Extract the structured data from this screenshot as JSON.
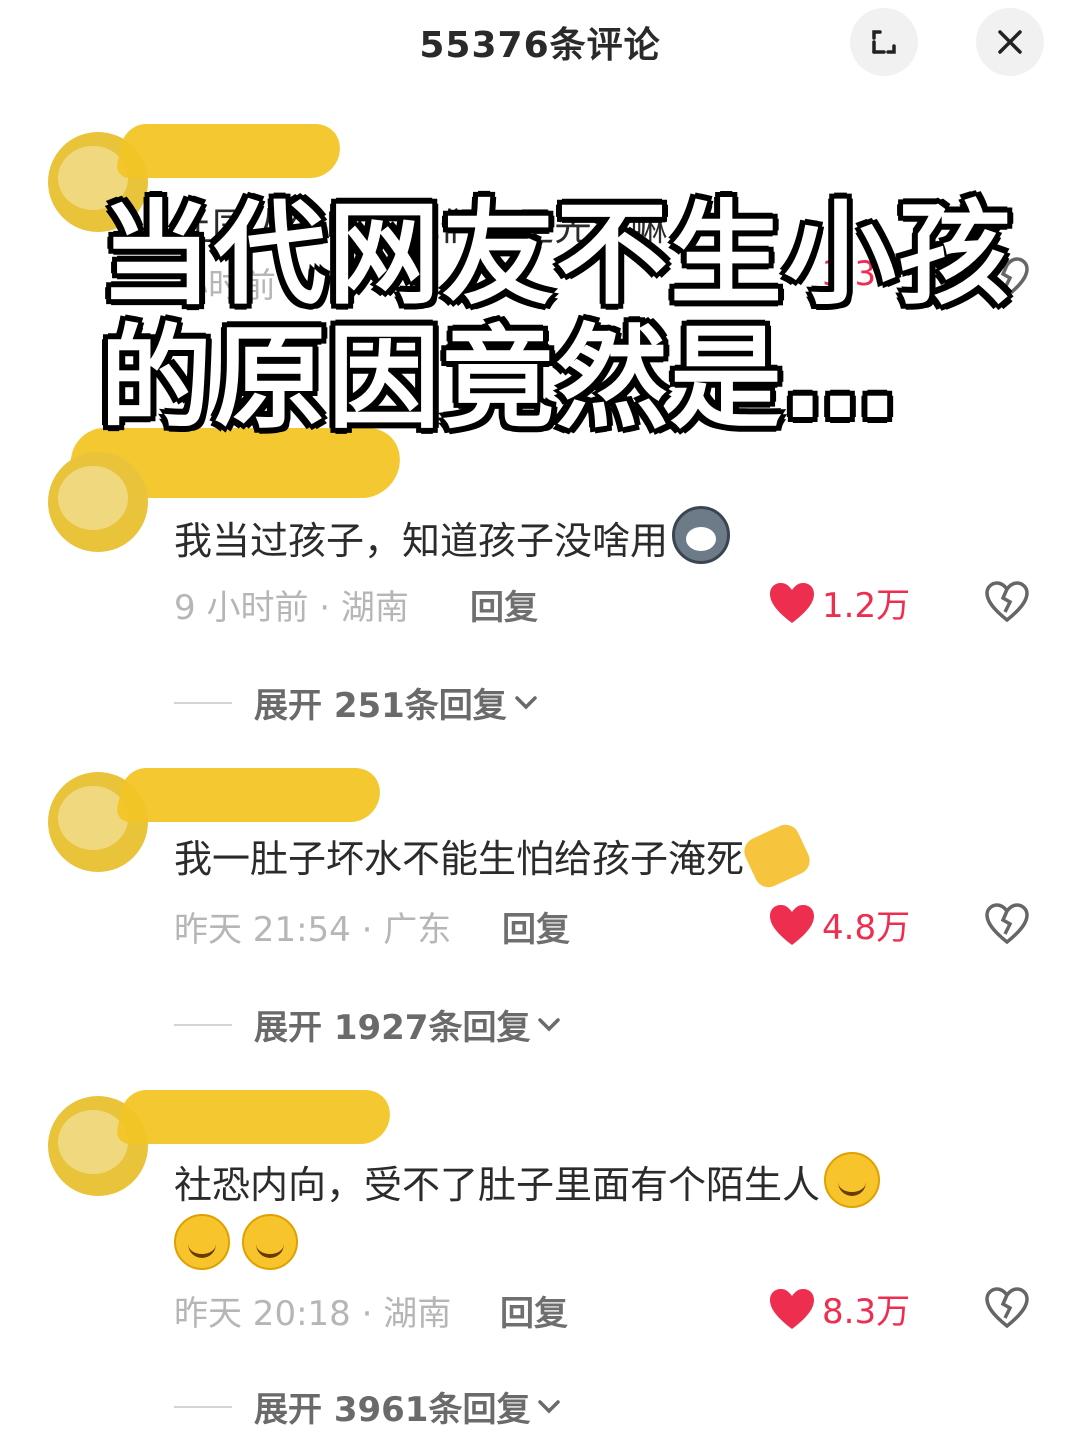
{
  "header": {
    "title": "55376条评论",
    "expand_icon": "expand-icon",
    "close_icon": "close-icon"
  },
  "overlay": {
    "line1": "当代网友不生小孩",
    "line2": "的原因竟然是…"
  },
  "ghost_comment": {
    "text": "让国人生吧，他们不是先生嘛",
    "meta": "小时前",
    "reply_label": "回复",
    "likes": "3.3"
  },
  "comments": [
    {
      "text": "我当过孩子，知道孩子没啥用",
      "emoji": "husky-emoji",
      "meta": "9 小时前 · 湖南",
      "reply_label": "回复",
      "likes": "1.2万",
      "expand_label": "展开 251条回复"
    },
    {
      "text": "我一肚子坏水不能生怕给孩子淹死",
      "emoji": "pointing-hand-emoji",
      "meta": "昨天 21:54 · 广东",
      "reply_label": "回复",
      "likes": "4.8万",
      "expand_label": "展开 1927条回复"
    },
    {
      "text": "社恐内向，受不了肚子里面有个陌生人",
      "emoji": "smirk-emoji",
      "meta": "昨天 20:18 · 湖南",
      "reply_label": "回复",
      "likes": "8.3万",
      "expand_label": "展开 3961条回复"
    }
  ],
  "colors": {
    "like": "#ee2e4f",
    "scribble": "#f2c526"
  }
}
